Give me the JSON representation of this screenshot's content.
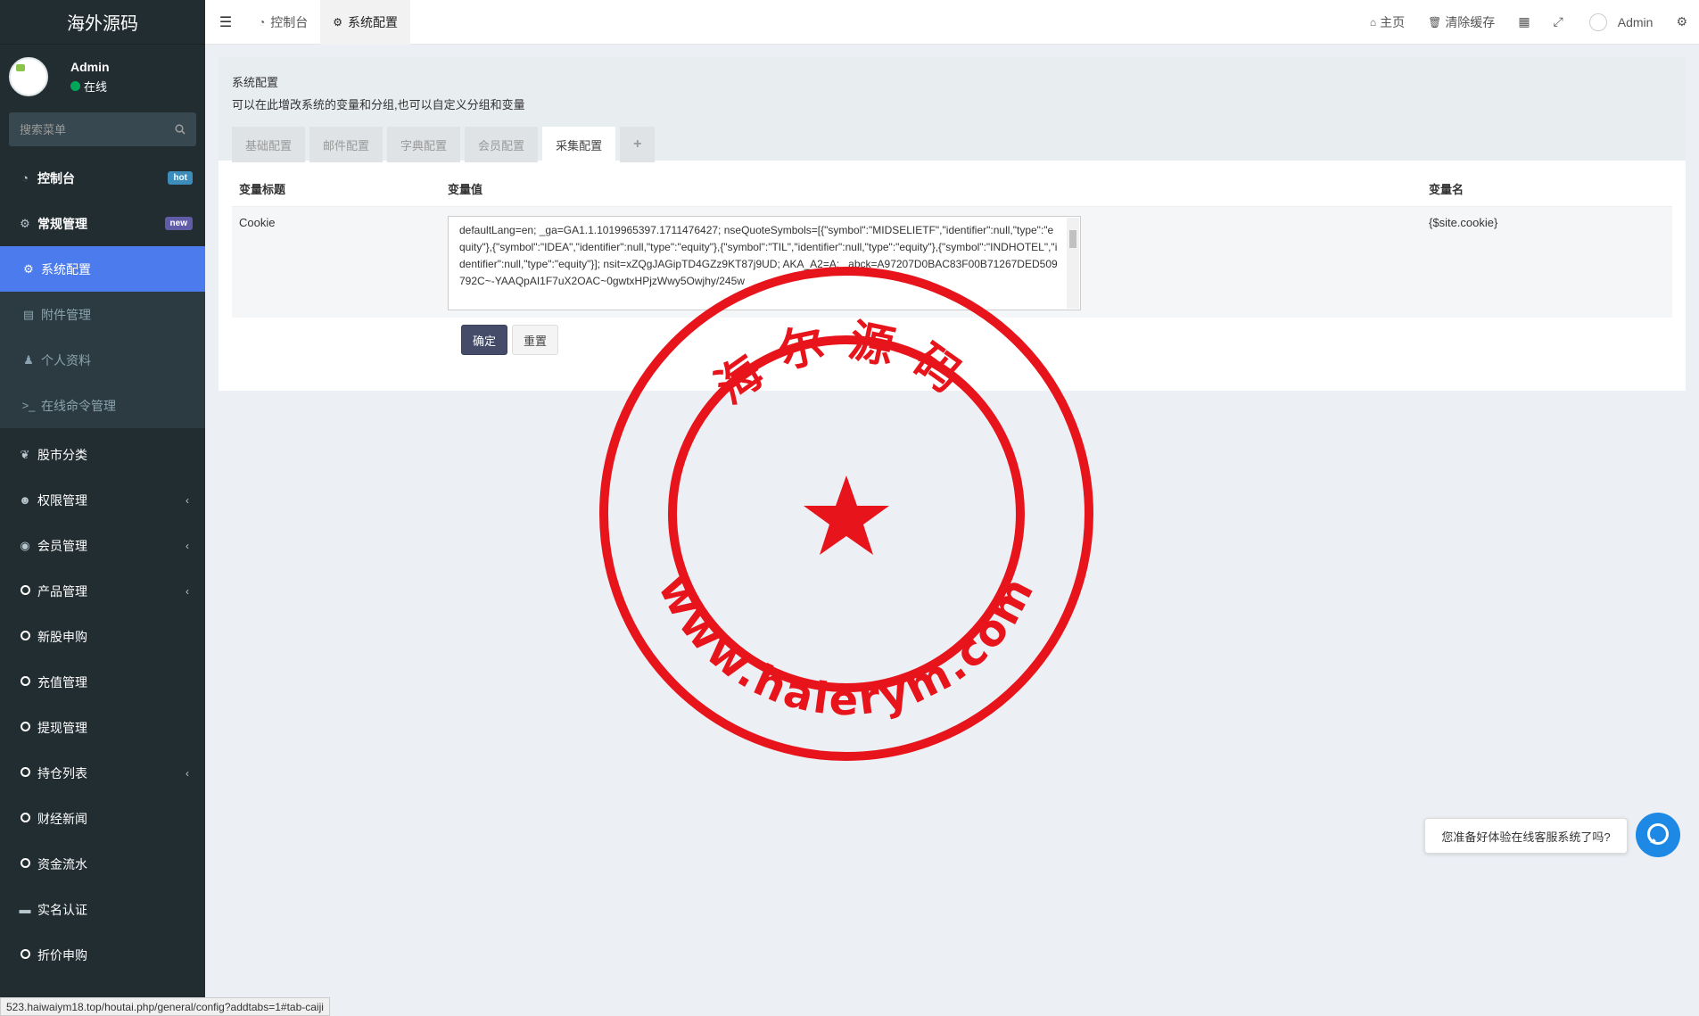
{
  "logo": "海外源码",
  "user": {
    "name": "Admin",
    "status": "在线"
  },
  "search": {
    "placeholder": "搜索菜单"
  },
  "menu": [
    {
      "label": "控制台",
      "icon": "dashboard-icon",
      "badge": "hot"
    },
    {
      "label": "常规管理",
      "icon": "cogs-icon",
      "badge": "new"
    },
    {
      "label": "系统配置",
      "icon": "gear-icon"
    },
    {
      "label": "附件管理",
      "icon": "file-image-icon"
    },
    {
      "label": "个人资料",
      "icon": "user-icon"
    },
    {
      "label": "在线命令管理",
      "icon": "terminal-icon"
    },
    {
      "label": "股市分类",
      "icon": "leaf-icon"
    },
    {
      "label": "权限管理",
      "icon": "group-icon"
    },
    {
      "label": "会员管理",
      "icon": "user-circle-icon"
    },
    {
      "label": "产品管理",
      "icon": "circle-icon"
    },
    {
      "label": "新股申购",
      "icon": "circle-icon"
    },
    {
      "label": "充值管理",
      "icon": "circle-icon"
    },
    {
      "label": "提现管理",
      "icon": "circle-icon"
    },
    {
      "label": "持仓列表",
      "icon": "circle-icon"
    },
    {
      "label": "财经新闻",
      "icon": "circle-icon"
    },
    {
      "label": "资金流水",
      "icon": "circle-icon"
    },
    {
      "label": "实名认证",
      "icon": "credit-card-icon"
    },
    {
      "label": "折价申购",
      "icon": "circle-icon"
    }
  ],
  "topbar": {
    "tabs": [
      {
        "label": "控制台",
        "icon": "dashboard-icon"
      },
      {
        "label": "系统配置",
        "icon": "gear-icon"
      }
    ],
    "home": "主页",
    "clear_cache": "清除缓存",
    "admin": "Admin"
  },
  "panel": {
    "title": "系统配置",
    "desc": "可以在此增改系统的变量和分组,也可以自定义分组和变量",
    "tabs": [
      "基础配置",
      "邮件配置",
      "字典配置",
      "会员配置",
      "采集配置",
      "+"
    ],
    "active_tab": "采集配置"
  },
  "table": {
    "headers": [
      "变量标题",
      "变量值",
      "变量名"
    ],
    "row": {
      "title": "Cookie",
      "value": "defaultLang=en; _ga=GA1.1.1019965397.1711476427; nseQuoteSymbols=[{\"symbol\":\"MIDSELIETF\",\"identifier\":null,\"type\":\"equity\"},{\"symbol\":\"IDEA\",\"identifier\":null,\"type\":\"equity\"},{\"symbol\":\"TIL\",\"identifier\":null,\"type\":\"equity\"},{\"symbol\":\"INDHOTEL\",\"identifier\":null,\"type\":\"equity\"}]; nsit=xZQgJAGipTD4GZz9KT87j9UD; AKA_A2=A; _abck=A97207D0BAC83F00B71267DED509792C~-YAAQpAI1F7uX2OAC~0gwtxHPjzWwy5Owjhy/245w",
      "name": "{$site.cookie}"
    }
  },
  "buttons": {
    "confirm": "确定",
    "reset": "重置"
  },
  "seal": {
    "top_text": "海尔源码",
    "bottom_text": "www.haierym.com",
    "color": "#e8141b"
  },
  "chat": {
    "prompt": "您准备好体验在线客服系统了吗?"
  },
  "status_url": "523.haiwaiym18.top/houtai.php/general/config?addtabs=1#tab-caiji"
}
